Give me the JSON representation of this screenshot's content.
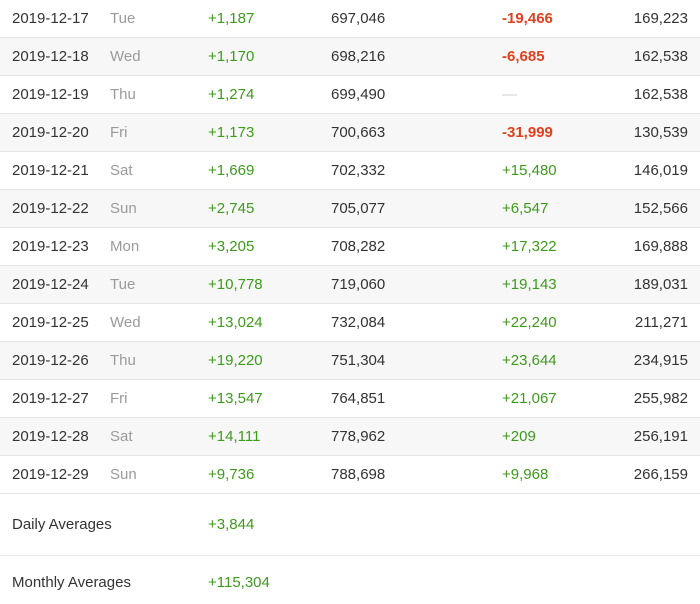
{
  "rows": [
    {
      "date": "2019-12-17",
      "day": "Tue",
      "gain": "+1,187",
      "total": "697,046",
      "change": "-19,466",
      "change_type": "neg",
      "value": "169,223"
    },
    {
      "date": "2019-12-18",
      "day": "Wed",
      "gain": "+1,170",
      "total": "698,216",
      "change": "-6,685",
      "change_type": "neg",
      "value": "162,538"
    },
    {
      "date": "2019-12-19",
      "day": "Thu",
      "gain": "+1,274",
      "total": "699,490",
      "change": "—",
      "change_type": "dash",
      "value": "162,538"
    },
    {
      "date": "2019-12-20",
      "day": "Fri",
      "gain": "+1,173",
      "total": "700,663",
      "change": "-31,999",
      "change_type": "neg",
      "value": "130,539"
    },
    {
      "date": "2019-12-21",
      "day": "Sat",
      "gain": "+1,669",
      "total": "702,332",
      "change": "+15,480",
      "change_type": "pos",
      "value": "146,019"
    },
    {
      "date": "2019-12-22",
      "day": "Sun",
      "gain": "+2,745",
      "total": "705,077",
      "change": "+6,547",
      "change_type": "pos",
      "value": "152,566"
    },
    {
      "date": "2019-12-23",
      "day": "Mon",
      "gain": "+3,205",
      "total": "708,282",
      "change": "+17,322",
      "change_type": "pos",
      "value": "169,888"
    },
    {
      "date": "2019-12-24",
      "day": "Tue",
      "gain": "+10,778",
      "total": "719,060",
      "change": "+19,143",
      "change_type": "pos",
      "value": "189,031"
    },
    {
      "date": "2019-12-25",
      "day": "Wed",
      "gain": "+13,024",
      "total": "732,084",
      "change": "+22,240",
      "change_type": "pos",
      "value": "211,271"
    },
    {
      "date": "2019-12-26",
      "day": "Thu",
      "gain": "+19,220",
      "total": "751,304",
      "change": "+23,644",
      "change_type": "pos",
      "value": "234,915"
    },
    {
      "date": "2019-12-27",
      "day": "Fri",
      "gain": "+13,547",
      "total": "764,851",
      "change": "+21,067",
      "change_type": "pos",
      "value": "255,982"
    },
    {
      "date": "2019-12-28",
      "day": "Sat",
      "gain": "+14,111",
      "total": "778,962",
      "change": "+209",
      "change_type": "pos",
      "value": "256,191"
    },
    {
      "date": "2019-12-29",
      "day": "Sun",
      "gain": "+9,736",
      "total": "788,698",
      "change": "+9,968",
      "change_type": "pos",
      "value": "266,159"
    }
  ],
  "averages": {
    "daily_label": "Daily Averages",
    "daily_value": "+3,844",
    "monthly_label": "Monthly Averages",
    "monthly_value": "+115,304"
  },
  "colors": {
    "positive": "#3d9a1b",
    "negative": "#e0401c",
    "muted": "#9a9a9a"
  }
}
